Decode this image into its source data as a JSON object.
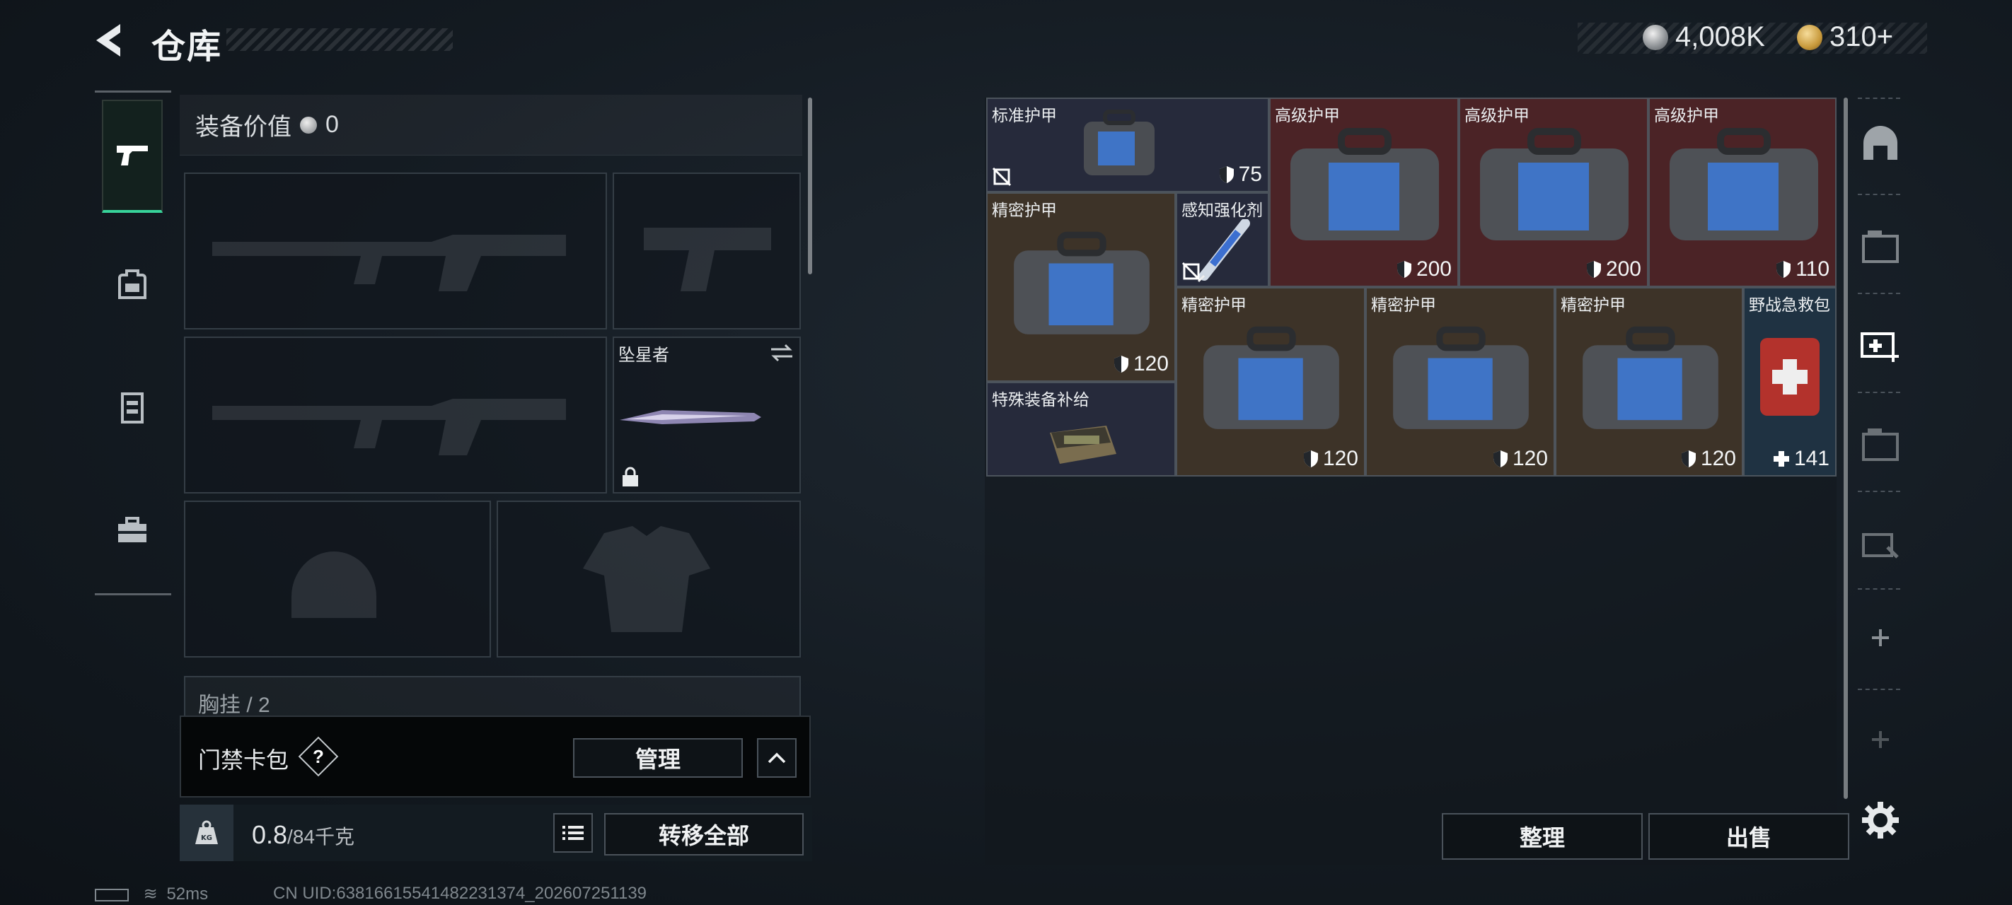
{
  "header": {
    "title": "仓库"
  },
  "currency": [
    {
      "icon": "silver-coin-icon",
      "value": "4,008K"
    },
    {
      "icon": "gold-coin-icon",
      "value": "310+"
    }
  ],
  "nav": [
    {
      "icon": "pistol-icon",
      "active": true
    },
    {
      "icon": "backpack-icon",
      "active": false
    },
    {
      "icon": "vest-icon",
      "active": false
    },
    {
      "icon": "toolbox-icon",
      "active": false
    }
  ],
  "equipment": {
    "value_label": "装备价值",
    "value": "0",
    "melee_name": "坠星者",
    "chest_rig_label": "胸挂 / 2"
  },
  "keycard": {
    "label": "门禁卡包",
    "help": "?",
    "manage": "管理"
  },
  "weight": {
    "current": "0.8",
    "max": "/84千克",
    "transfer_all": "转移全部"
  },
  "storage": {
    "items": [
      {
        "name": "标准护甲",
        "value": "75",
        "kind": "shield"
      },
      {
        "name": "高级护甲",
        "value": "200",
        "kind": "shield"
      },
      {
        "name": "高级护甲",
        "value": "200",
        "kind": "shield"
      },
      {
        "name": "高级护甲",
        "value": "110",
        "kind": "shield"
      },
      {
        "name": "精密护甲",
        "value": "120",
        "kind": "shield"
      },
      {
        "name": "感知强化剂",
        "value": "",
        "kind": ""
      },
      {
        "name": "精密护甲",
        "value": "120",
        "kind": "shield"
      },
      {
        "name": "精密护甲",
        "value": "120",
        "kind": "shield"
      },
      {
        "name": "精密护甲",
        "value": "120",
        "kind": "shield"
      },
      {
        "name": "野战急救包",
        "value": "141",
        "kind": "heal"
      },
      {
        "name": "特殊装备补给",
        "value": "",
        "kind": ""
      }
    ],
    "sort": "整理",
    "sell": "出售"
  },
  "status": {
    "ping": "52ms",
    "uid": "CN UID:63816615541482231374_202607251139"
  },
  "colors": {
    "accent": "#37d39a",
    "panel_red": "#4b2326",
    "panel_brown": "#3d3328",
    "panel_gray": "#262c3a"
  }
}
